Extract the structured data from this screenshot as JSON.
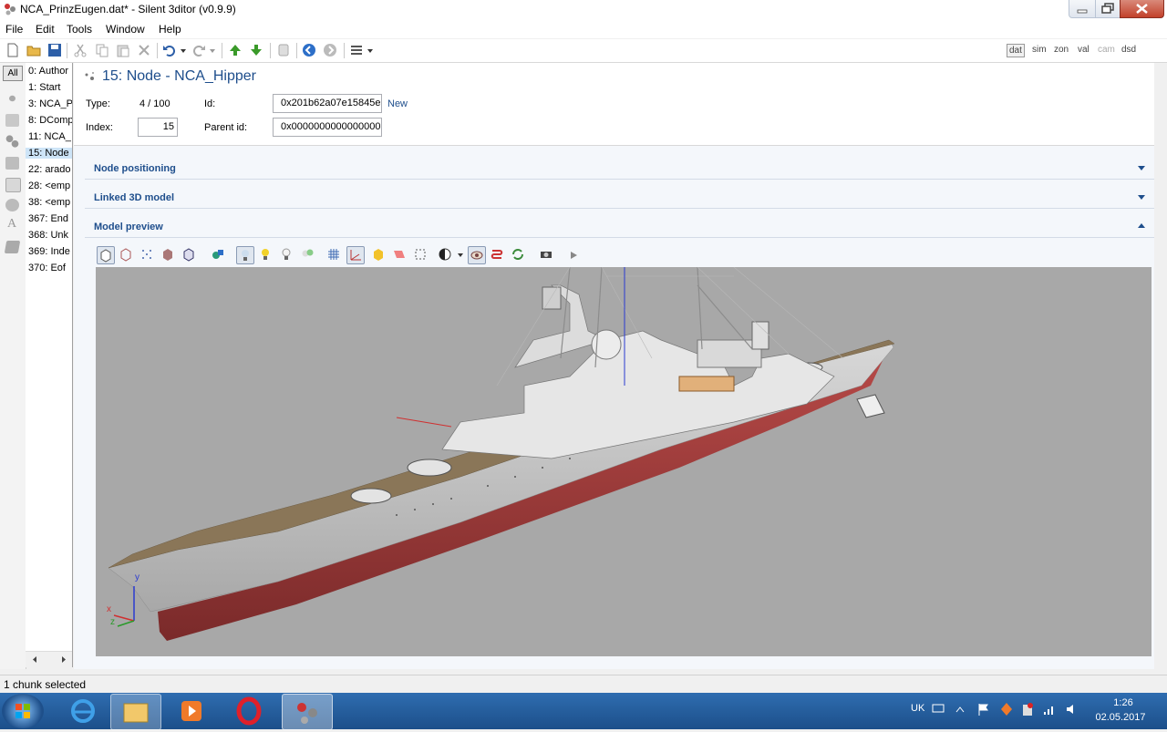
{
  "window": {
    "title": "NCA_PrinzEugen.dat* - Silent 3ditor (v0.9.9)"
  },
  "menu": [
    "File",
    "Edit",
    "Tools",
    "Window",
    "Help"
  ],
  "toolbar": {
    "file_tabs": [
      "dat",
      "sim",
      "zon",
      "val",
      "cam",
      "dsd"
    ],
    "active_tab": "dat"
  },
  "left_strip": {
    "all_label": "All",
    "icon_letter": "A"
  },
  "chunks": [
    "0: Author",
    "1: Start",
    "3: NCA_P",
    "8: DComp",
    "11: NCA_",
    "15: Node",
    "22: arado",
    "28: <emp",
    "38: <emp",
    "367: End",
    "368: Unk",
    "369: Inde",
    "370: Eof"
  ],
  "selected_chunk_index": 5,
  "node": {
    "title": "15: Node - NCA_Hipper",
    "type_label": "Type:",
    "type_value": "4 / 100",
    "id_label": "Id:",
    "id_value": "0x201b62a07e15845e",
    "new_link": "New",
    "index_label": "Index:",
    "index_value": "15",
    "parent_label": "Parent id:",
    "parent_value": "0x0000000000000000"
  },
  "sections": [
    {
      "label": "Node positioning",
      "expanded": false
    },
    {
      "label": "Linked 3D model",
      "expanded": false
    },
    {
      "label": "Model preview",
      "expanded": true
    }
  ],
  "gizmo": {
    "x": "x",
    "y": "y",
    "z": "z"
  },
  "status": {
    "text": "1 chunk selected"
  },
  "tray": {
    "lang": "UK",
    "time": "1:26",
    "date": "02.05.2017"
  },
  "colors": {
    "accent": "#1e4e8c",
    "hull_red": "#a3383a",
    "hull_grey": "#c9c9c9",
    "viewport_bg": "#a8a8a8"
  }
}
